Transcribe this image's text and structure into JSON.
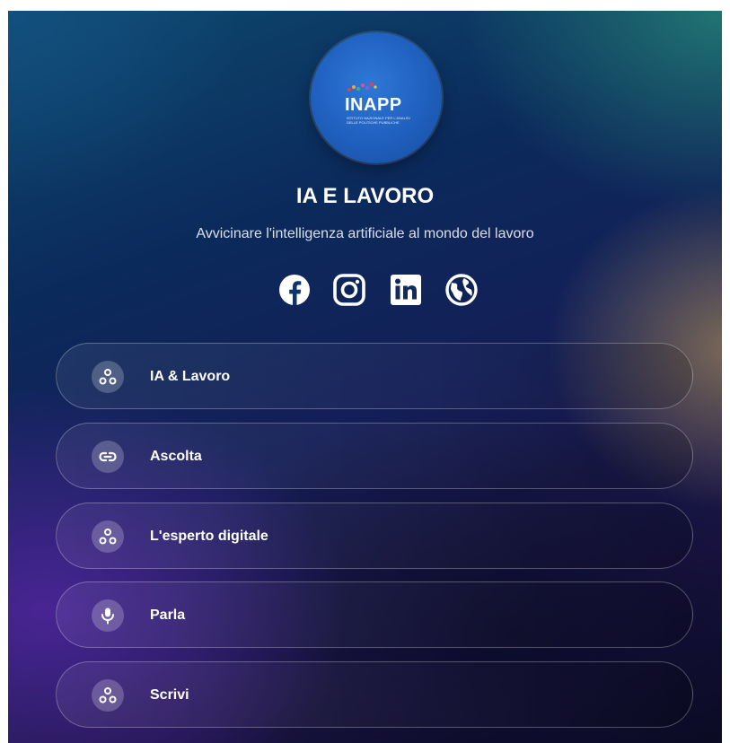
{
  "profile": {
    "logo_text": "INAPP",
    "logo_subtext": "ISTITUTO NAZIONALE PER L'ANALISI DELLE POLITICHE PUBBLICHE",
    "title": "IA E LAVORO",
    "subtitle": "Avvicinare l'intelligenza artificiale al mondo del lavoro"
  },
  "socials": [
    {
      "name": "Facebook",
      "icon": "facebook-icon"
    },
    {
      "name": "Instagram",
      "icon": "instagram-icon"
    },
    {
      "name": "LinkedIn",
      "icon": "linkedin-icon"
    },
    {
      "name": "Website",
      "icon": "globe-icon"
    }
  ],
  "links": [
    {
      "label": "IA & Lavoro",
      "icon": "nodes-icon"
    },
    {
      "label": "Ascolta",
      "icon": "link-icon"
    },
    {
      "label": "L'esperto digitale",
      "icon": "nodes-icon"
    },
    {
      "label": "Parla",
      "icon": "microphone-icon"
    },
    {
      "label": "Scrivi",
      "icon": "nodes-icon"
    }
  ],
  "colors": {
    "logo_blue": "#1f5fbe",
    "text": "#ffffff"
  }
}
